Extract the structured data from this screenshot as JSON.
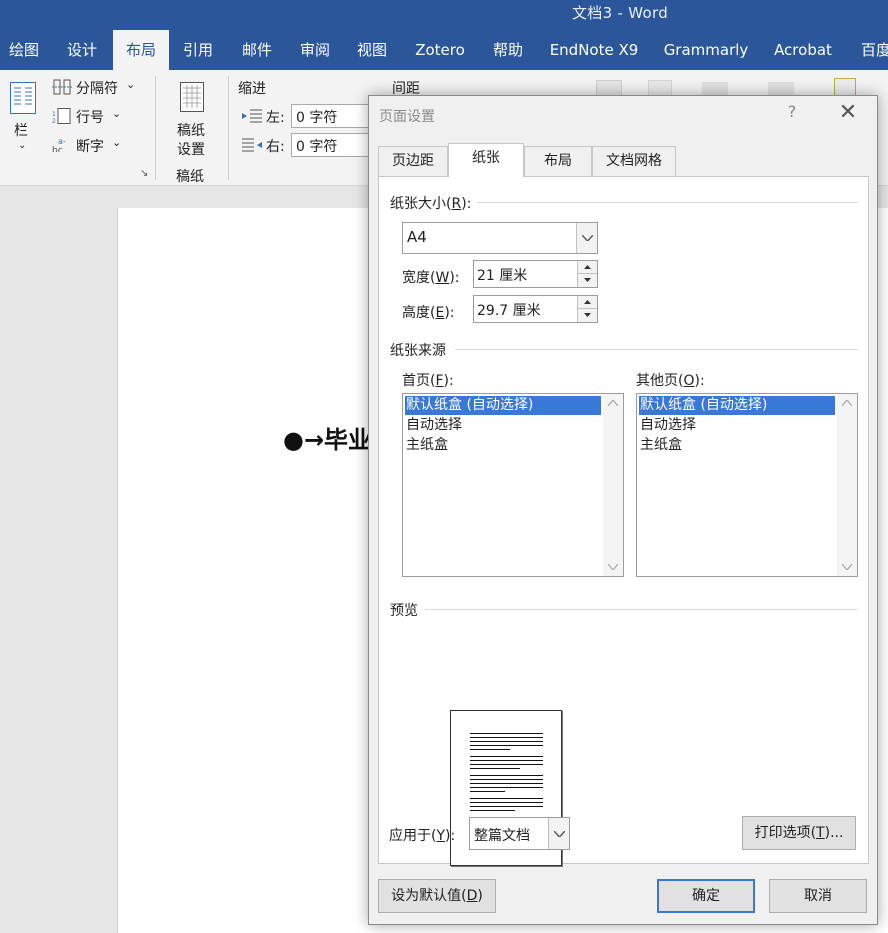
{
  "window": {
    "title": "文档3  -  Word"
  },
  "ribbon_tabs": [
    {
      "label": "绘图",
      "active": false
    },
    {
      "label": "设计",
      "active": false
    },
    {
      "label": "布局",
      "active": true
    },
    {
      "label": "引用",
      "active": false
    },
    {
      "label": "邮件",
      "active": false
    },
    {
      "label": "审阅",
      "active": false
    },
    {
      "label": "视图",
      "active": false
    },
    {
      "label": "Zotero",
      "active": false
    },
    {
      "label": "帮助",
      "active": false
    },
    {
      "label": "EndNote X9",
      "active": false
    },
    {
      "label": "Grammarly",
      "active": false
    },
    {
      "label": "Acrobat",
      "active": false
    },
    {
      "label": "百度",
      "active": false
    }
  ],
  "ribbon": {
    "columns_label": "栏",
    "breaks_label": "分隔符",
    "line_numbers_label": "行号",
    "hyphenation_label": "断字",
    "paper_setup_line1": "稿纸",
    "paper_setup_line2": "设置",
    "paper_group_label": "稿纸",
    "indent_label": "缩进",
    "indent_left_label": "左:",
    "indent_left_value": "0 字符",
    "indent_right_label": "右:",
    "indent_right_value": "0 字符",
    "spacing_label": "间距"
  },
  "document": {
    "heading": "●→毕业"
  },
  "dialog": {
    "title": "页面设置",
    "help": "?",
    "close": "✕",
    "tabs": [
      {
        "label": "页边距",
        "active": false
      },
      {
        "label": "纸张",
        "active": true
      },
      {
        "label": "布局",
        "active": false
      },
      {
        "label": "文档网格",
        "active": false
      }
    ],
    "paper_size": {
      "label_main": "纸张大小(",
      "label_key": "R",
      "label_end": "):",
      "value": "A4",
      "width_label_main": "宽度(",
      "width_label_key": "W",
      "width_label_end": "):",
      "width_value": "21 厘米",
      "height_label_main": "高度(",
      "height_label_key": "E",
      "height_label_end": "):",
      "height_value": "29.7 厘米"
    },
    "paper_source": {
      "label": "纸张来源",
      "first_page_main": "首页(",
      "first_page_key": "F",
      "first_page_end": "):",
      "other_pages_main": "其他页(",
      "other_pages_key": "O",
      "other_pages_end": "):",
      "first_page_items": [
        "默认纸盒 (自动选择)",
        "自动选择",
        "主纸盒"
      ],
      "other_pages_items": [
        "默认纸盒 (自动选择)",
        "自动选择",
        "主纸盒"
      ]
    },
    "preview": {
      "label": "预览"
    },
    "apply_to": {
      "label_main": "应用于(",
      "label_key": "Y",
      "label_end": "):",
      "value": "整篇文档"
    },
    "buttons": {
      "print_options_main": "打印选项(",
      "print_options_key": "T",
      "print_options_end": ")...",
      "set_default_main": "设为默认值(",
      "set_default_key": "D",
      "set_default_end": ")",
      "ok": "确定",
      "cancel": "取消"
    }
  },
  "colors": {
    "word_blue": "#2b579a",
    "selection_blue": "#3a78d8"
  }
}
